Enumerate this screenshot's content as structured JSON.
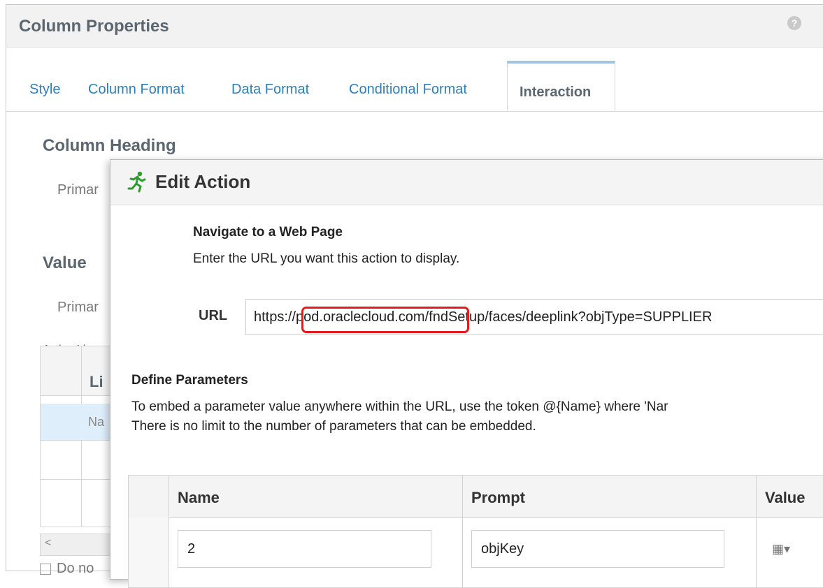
{
  "background_panel": {
    "title": "Column Properties",
    "help_icon": "?",
    "tabs": [
      "Style",
      "Column Format",
      "Data Format",
      "Conditional Format",
      "Interaction"
    ],
    "active_tab": "Interaction",
    "column_heading": "Column Heading",
    "primary_label_1": "Primar",
    "value_heading": "Value",
    "primary_label_2": "Primar",
    "action_links_label": "Action Lin",
    "links_table_header": "Li",
    "links_table_row": "Na",
    "scroll_left": "<",
    "checkbox_label": "Do no"
  },
  "edit_action": {
    "title": "Edit Action",
    "navigate_title": "Navigate to a Web Page",
    "navigate_desc": "Enter the URL you want this action to display.",
    "url_label": "URL",
    "url_value": "https://pod.oraclecloud.com/fndSetup/faces/deeplink?objType=SUPPLIER",
    "define_title": "Define Parameters",
    "define_desc_1": "To embed a parameter value anywhere within the URL, use the token @{Name} where 'Nar",
    "define_desc_2": "There is no limit to the number of parameters that can be embedded.",
    "table": {
      "headers": [
        "Name",
        "Prompt",
        "Value"
      ],
      "rows": [
        {
          "name": "2",
          "prompt": "objKey"
        }
      ]
    },
    "colors": {
      "highlight": "#e51b1b",
      "tab_link": "#2f7fb8"
    }
  }
}
